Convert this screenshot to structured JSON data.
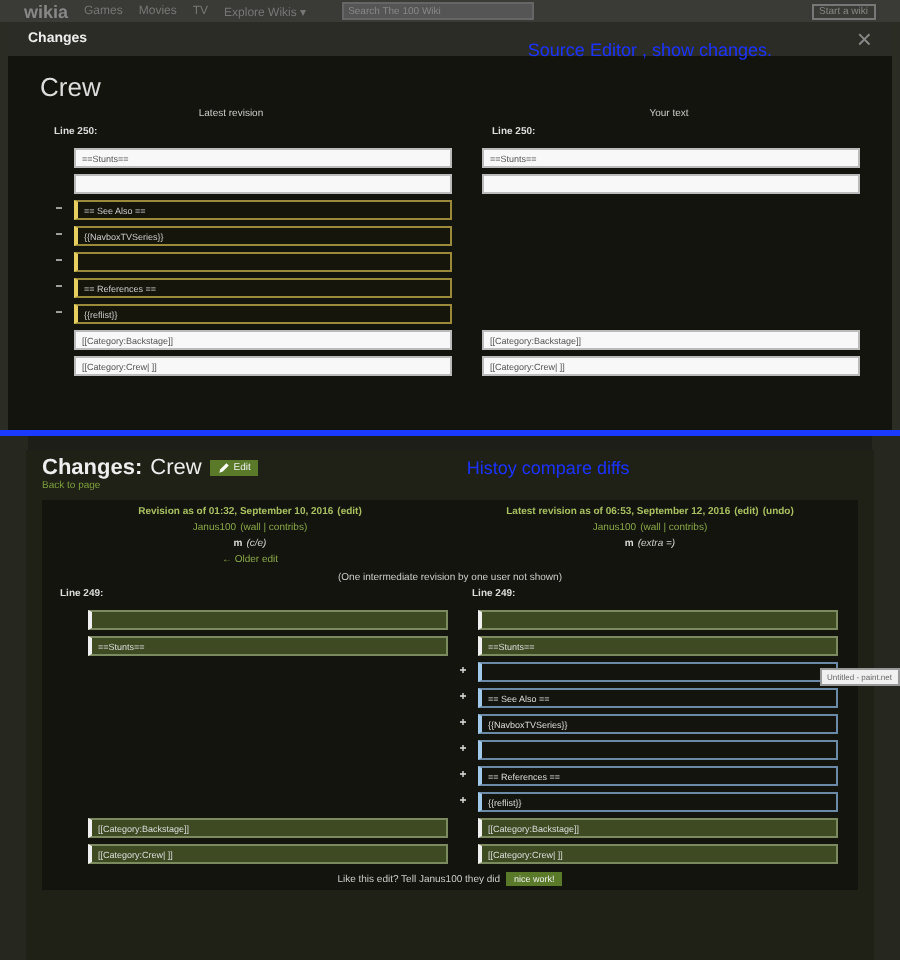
{
  "site_header": {
    "logo": "wikia",
    "nav": [
      "Games",
      "Movies",
      "TV",
      "Explore Wikis ▾"
    ],
    "search": {
      "placeholder": "Search The 100 Wiki"
    },
    "start_button": "Start a wiki"
  },
  "modal": {
    "title": "Changes",
    "close": "×",
    "annotation": "Source Editor , show changes.",
    "page_title": "Crew",
    "left_heading": "Latest revision",
    "right_heading": "Your text",
    "left_line": "Line 250:",
    "right_line": "Line 250:",
    "rows": [
      {
        "left": {
          "kind": "context",
          "text": "==Stunts=="
        },
        "right": {
          "kind": "context",
          "text": "==Stunts=="
        }
      },
      {
        "left": {
          "kind": "context"
        },
        "right": {
          "kind": "context"
        }
      },
      {
        "left": {
          "kind": "deleted",
          "marker": "−",
          "text": "== See Also =="
        },
        "right": {
          "kind": "none"
        }
      },
      {
        "left": {
          "kind": "deleted",
          "marker": "−",
          "text": "{{NavboxTVSeries}}"
        },
        "right": {
          "kind": "none"
        }
      },
      {
        "left": {
          "kind": "deleted",
          "marker": "−"
        },
        "right": {
          "kind": "none"
        }
      },
      {
        "left": {
          "kind": "deleted",
          "marker": "−",
          "text": "== References =="
        },
        "right": {
          "kind": "none"
        }
      },
      {
        "left": {
          "kind": "deleted",
          "marker": "−",
          "text": "{{reflist}}"
        },
        "right": {
          "kind": "none"
        }
      },
      {
        "left": {
          "kind": "context",
          "text": "[[Category:Backstage]]"
        },
        "right": {
          "kind": "context",
          "text": "[[Category:Backstage]]"
        }
      },
      {
        "left": {
          "kind": "context",
          "text": "[[Category:Crew| ]]"
        },
        "right": {
          "kind": "context",
          "text": "[[Category:Crew| ]]"
        }
      }
    ]
  },
  "history": {
    "title_prefix": "Changes:",
    "page_title": "Crew",
    "edit_button": "Edit",
    "annotation": "Histoy compare diffs",
    "back_link": "Back to page",
    "revisions": [
      {
        "heading": "Revision as of 01:32, September 10, 2016",
        "actions": [
          "(edit)"
        ],
        "user": "Janus100",
        "user_links": "(wall | contribs)",
        "minor": "m",
        "summary": "(c/e)",
        "nav_link": "← Older edit"
      },
      {
        "heading": "Latest revision as of 06:53, September 12, 2016",
        "actions": [
          "(edit)",
          "(undo)"
        ],
        "user": "Janus100",
        "user_links": "(wall | contribs)",
        "minor": "m",
        "summary": "(extra =)"
      }
    ],
    "intermediate_note": "(One intermediate revision by one user not shown)",
    "left_line": "Line 249:",
    "right_line": "Line 249:",
    "rows": [
      {
        "left": {
          "kind": "context"
        },
        "right": {
          "kind": "context"
        }
      },
      {
        "left": {
          "kind": "context",
          "text": "==Stunts=="
        },
        "right": {
          "kind": "context",
          "text": "==Stunts=="
        }
      },
      {
        "left": {
          "kind": "none"
        },
        "right": {
          "kind": "added",
          "marker": "+"
        }
      },
      {
        "left": {
          "kind": "none"
        },
        "right": {
          "kind": "added",
          "marker": "+",
          "text": "== See Also =="
        }
      },
      {
        "left": {
          "kind": "none"
        },
        "right": {
          "kind": "added",
          "marker": "+",
          "text": "{{NavboxTVSeries}}"
        }
      },
      {
        "left": {
          "kind": "none"
        },
        "right": {
          "kind": "added",
          "marker": "+"
        }
      },
      {
        "left": {
          "kind": "none"
        },
        "right": {
          "kind": "added",
          "marker": "+",
          "text": "== References =="
        }
      },
      {
        "left": {
          "kind": "none"
        },
        "right": {
          "kind": "added",
          "marker": "+",
          "text": "{{reflist}}"
        }
      },
      {
        "left": {
          "kind": "context",
          "text": "[[Category:Backstage]]"
        },
        "right": {
          "kind": "context",
          "text": "[[Category:Backstage]]"
        }
      },
      {
        "left": {
          "kind": "context",
          "text": "[[Category:Crew| ]]"
        },
        "right": {
          "kind": "context",
          "text": "[[Category:Crew| ]]"
        }
      }
    ],
    "thanks_text": "Like this edit? Tell Janus100 they did",
    "thanks_button": "nice work!",
    "tooltip": "Untitled - paint.net"
  }
}
